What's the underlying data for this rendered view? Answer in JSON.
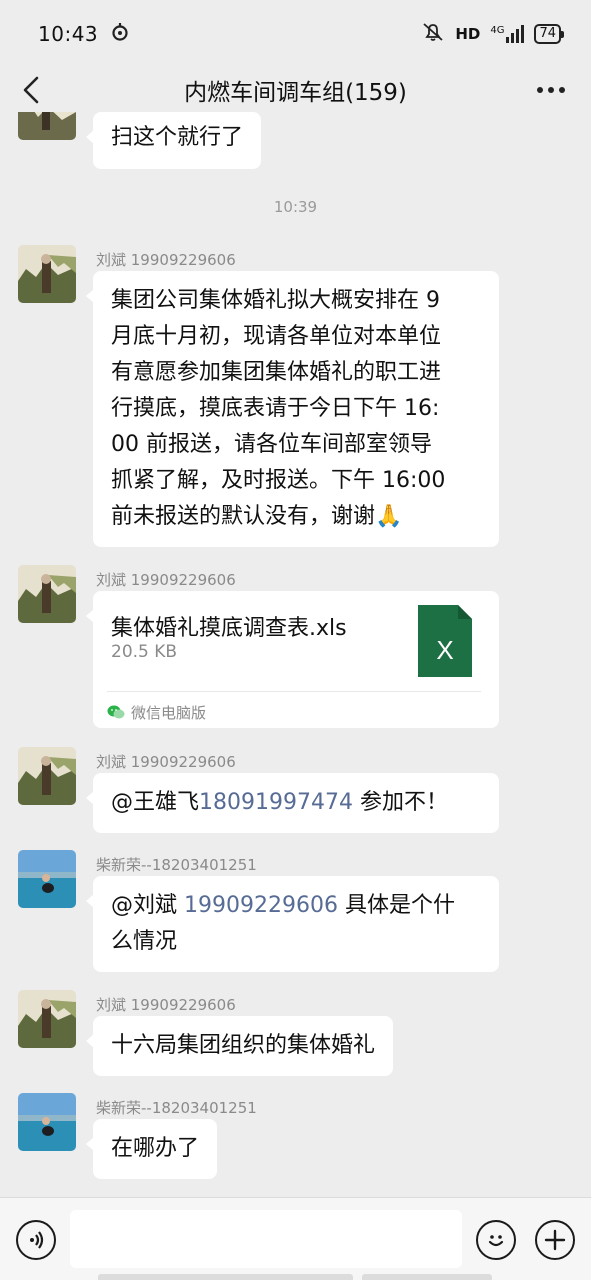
{
  "status_bar": {
    "time": "10:43",
    "network_label": "HD",
    "signal_label": "4G",
    "battery": "74"
  },
  "header": {
    "title": "内燃车间调车组(159)"
  },
  "messages": {
    "m0": {
      "text": "扫这个就行了"
    },
    "time_1039": "10:39",
    "m1": {
      "sender": "刘斌 19909229606",
      "lines": [
        "集团公司集体婚礼拟大概安排在 9",
        "月底十月初，现请各单位对本单位",
        "有意愿参加集团集体婚礼的职工进",
        "行摸底，摸底表请于今日下午 16:",
        "00 前报送，请各位车间部室领导",
        "抓紧了解，及时报送。下午 16:00",
        "前未报送的默认没有，谢谢"
      ],
      "emoji": "🙏"
    },
    "m2": {
      "sender": "刘斌 19909229606",
      "file_name": "集体婚礼摸底调查表.xls",
      "file_size": "20.5 KB",
      "file_icon_letter": "X",
      "source": "微信电脑版"
    },
    "m3": {
      "sender": "刘斌 19909229606",
      "mention": "@王雄飞",
      "number": "18091997474",
      "text": " 参加不！"
    },
    "m4": {
      "sender": "柴新荣--18203401251",
      "mention": "@刘斌",
      "number": "19909229606",
      "text": " 具体是个什",
      "line2": "么情况"
    },
    "m5": {
      "sender": "刘斌 19909229606",
      "text": "十六局集团组织的集体婚礼"
    },
    "m6": {
      "sender": "柴新荣--18203401251",
      "text": "在哪办了"
    }
  },
  "colors": {
    "background": "#ededed",
    "bubble": "#ffffff",
    "mention": "#576b95",
    "excel_green": "#1d7044"
  }
}
